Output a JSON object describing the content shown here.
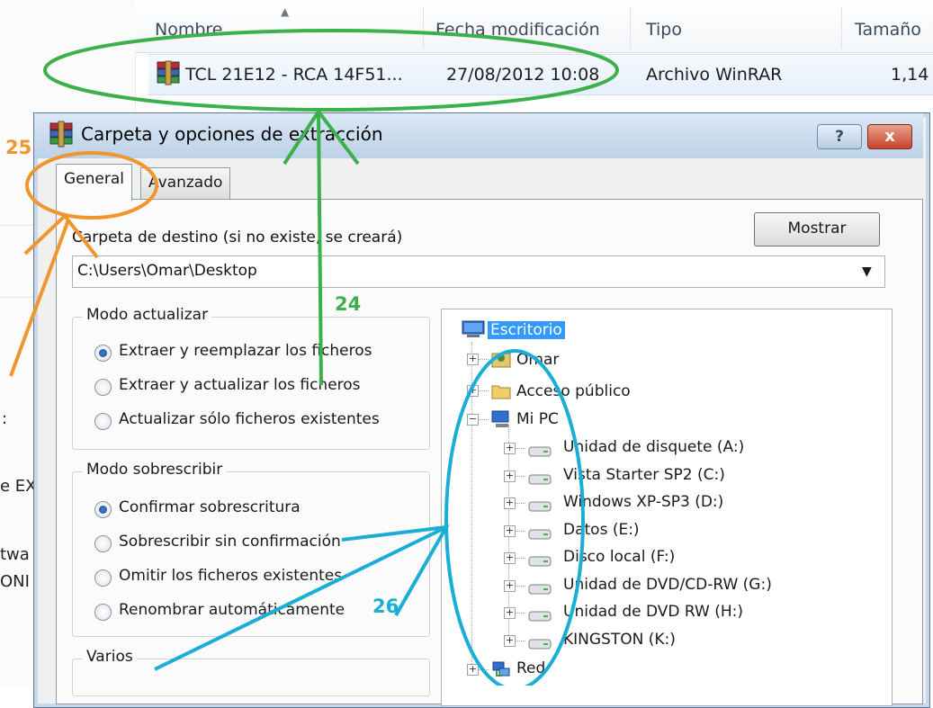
{
  "explorer": {
    "columns": [
      "Nombre",
      "Fecha modificación",
      "Tipo",
      "Tamaño"
    ],
    "file": {
      "name": "TCL 21E12 - RCA 14F51...",
      "date": "27/08/2012 10:08",
      "type": "Archivo WinRAR",
      "size": "1,14"
    },
    "left_fragments": [
      ":",
      "e EX",
      "twa",
      "ONI"
    ]
  },
  "dialog": {
    "title": "Carpeta y opciones de extracción",
    "help_label": "?",
    "close_label": "x",
    "tabs": [
      "General",
      "Avanzado"
    ],
    "active_tab": "General",
    "dest_label": "Carpeta de destino (si no existe, se creará)",
    "show_button": "Mostrar",
    "dest_path": "C:\\Users\\Omar\\Desktop",
    "update_mode": {
      "title": "Modo actualizar",
      "options": [
        "Extraer y reemplazar los ficheros",
        "Extraer y actualizar los ficheros",
        "Actualizar sólo ficheros existentes"
      ],
      "selected": 0
    },
    "overwrite_mode": {
      "title": "Modo sobrescribir",
      "options": [
        "Confirmar sobrescritura",
        "Sobrescribir sin confirmación",
        "Omitir los ficheros existentes",
        "Renombrar automáticamente"
      ],
      "selected": 0
    },
    "misc": {
      "title": "Varios"
    },
    "tree": {
      "root": "Escritorio",
      "level1": [
        "Omar",
        "Acceso público",
        "Mi PC"
      ],
      "drives": [
        "Unidad de disquete (A:)",
        "Vista Starter SP2 (C:)",
        "Windows XP-SP3 (D:)",
        "Datos (E:)",
        "Disco local (F:)",
        "Unidad de DVD/CD-RW (G:)",
        "Unidad de DVD RW (H:)",
        "KINGSTON (K:)"
      ],
      "last": "Red"
    }
  },
  "annotations": {
    "labels": [
      "25",
      "24",
      "26"
    ],
    "colors": {
      "green": "#3cb04a",
      "orange": "#f0962e",
      "cyan": "#1aaed6"
    }
  }
}
